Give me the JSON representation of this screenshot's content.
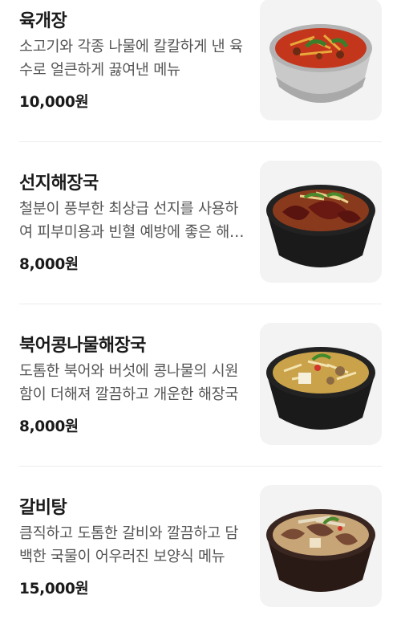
{
  "menu": {
    "items": [
      {
        "name": "육개장",
        "description": "소고기와 각종 나물에 칼칼하게 낸 육수로 얼큰하게 끓여낸 메뉴",
        "price": "10,000원",
        "image_icon": "yukgaejang-bowl-image"
      },
      {
        "name": "선지해장국",
        "description": "철분이 풍부한 최상급 선지를 사용하여 피부미용과 빈혈 예방에 좋은 해장국",
        "price": "8,000원",
        "image_icon": "seonji-haejangguk-bowl-image"
      },
      {
        "name": "북어콩나물해장국",
        "description": "도톰한 북어와 버섯에 콩나물의 시원함이 더해져 깔끔하고 개운한 해장국",
        "price": "8,000원",
        "image_icon": "bugeo-kongnamul-haejangguk-bowl-image"
      },
      {
        "name": "갈비탕",
        "description": "큼직하고 도톰한 갈비와 깔끔하고 담백한 국물이 어우러진 보양식 메뉴",
        "price": "15,000원",
        "image_icon": "galbitang-bowl-image"
      }
    ]
  },
  "colors": {
    "text_primary": "#1a1a1a",
    "text_secondary": "#555555",
    "divider": "#ececec",
    "thumb_background": "#f3f3f3"
  }
}
